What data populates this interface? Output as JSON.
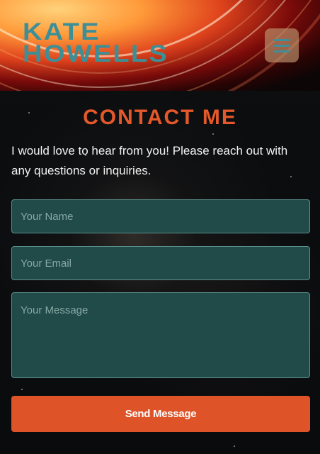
{
  "header": {
    "logo_line1": "KATE",
    "logo_line2": "HOWELLS",
    "menu_icon": "hamburger-menu-icon"
  },
  "contact": {
    "title": "CONTACT ME",
    "intro": "I would love to hear from you! Please reach out with any questions or inquiries.",
    "name_placeholder": "Your Name",
    "email_placeholder": "Your Email",
    "message_placeholder": "Your Message",
    "send_label": "Send Message"
  },
  "colors": {
    "accent": "#de5428",
    "logo": "#3d8f97",
    "field_bg": "#214b49"
  }
}
